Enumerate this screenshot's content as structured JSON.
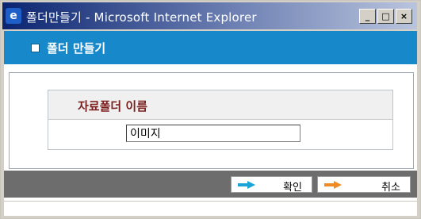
{
  "window": {
    "title": "폴더만들기 - Microsoft Internet Explorer",
    "app_icon": "e",
    "controls": [
      {
        "name": "minimize",
        "glyph": "_"
      },
      {
        "name": "maximize",
        "glyph": "□"
      },
      {
        "name": "close",
        "glyph": "×"
      }
    ]
  },
  "header": {
    "title": "폴더 만들기"
  },
  "form": {
    "label": "자료폴더 이름",
    "folder_name_value": "이미지"
  },
  "buttons": {
    "ok_label": "확인",
    "cancel_label": "취소"
  },
  "colors": {
    "header_bar": "#1788c9",
    "label_text": "#7b1e1e",
    "footer_bar": "#6d6d6d",
    "ok_arrow": "#1aa3d6",
    "cancel_arrow": "#f08a24"
  }
}
